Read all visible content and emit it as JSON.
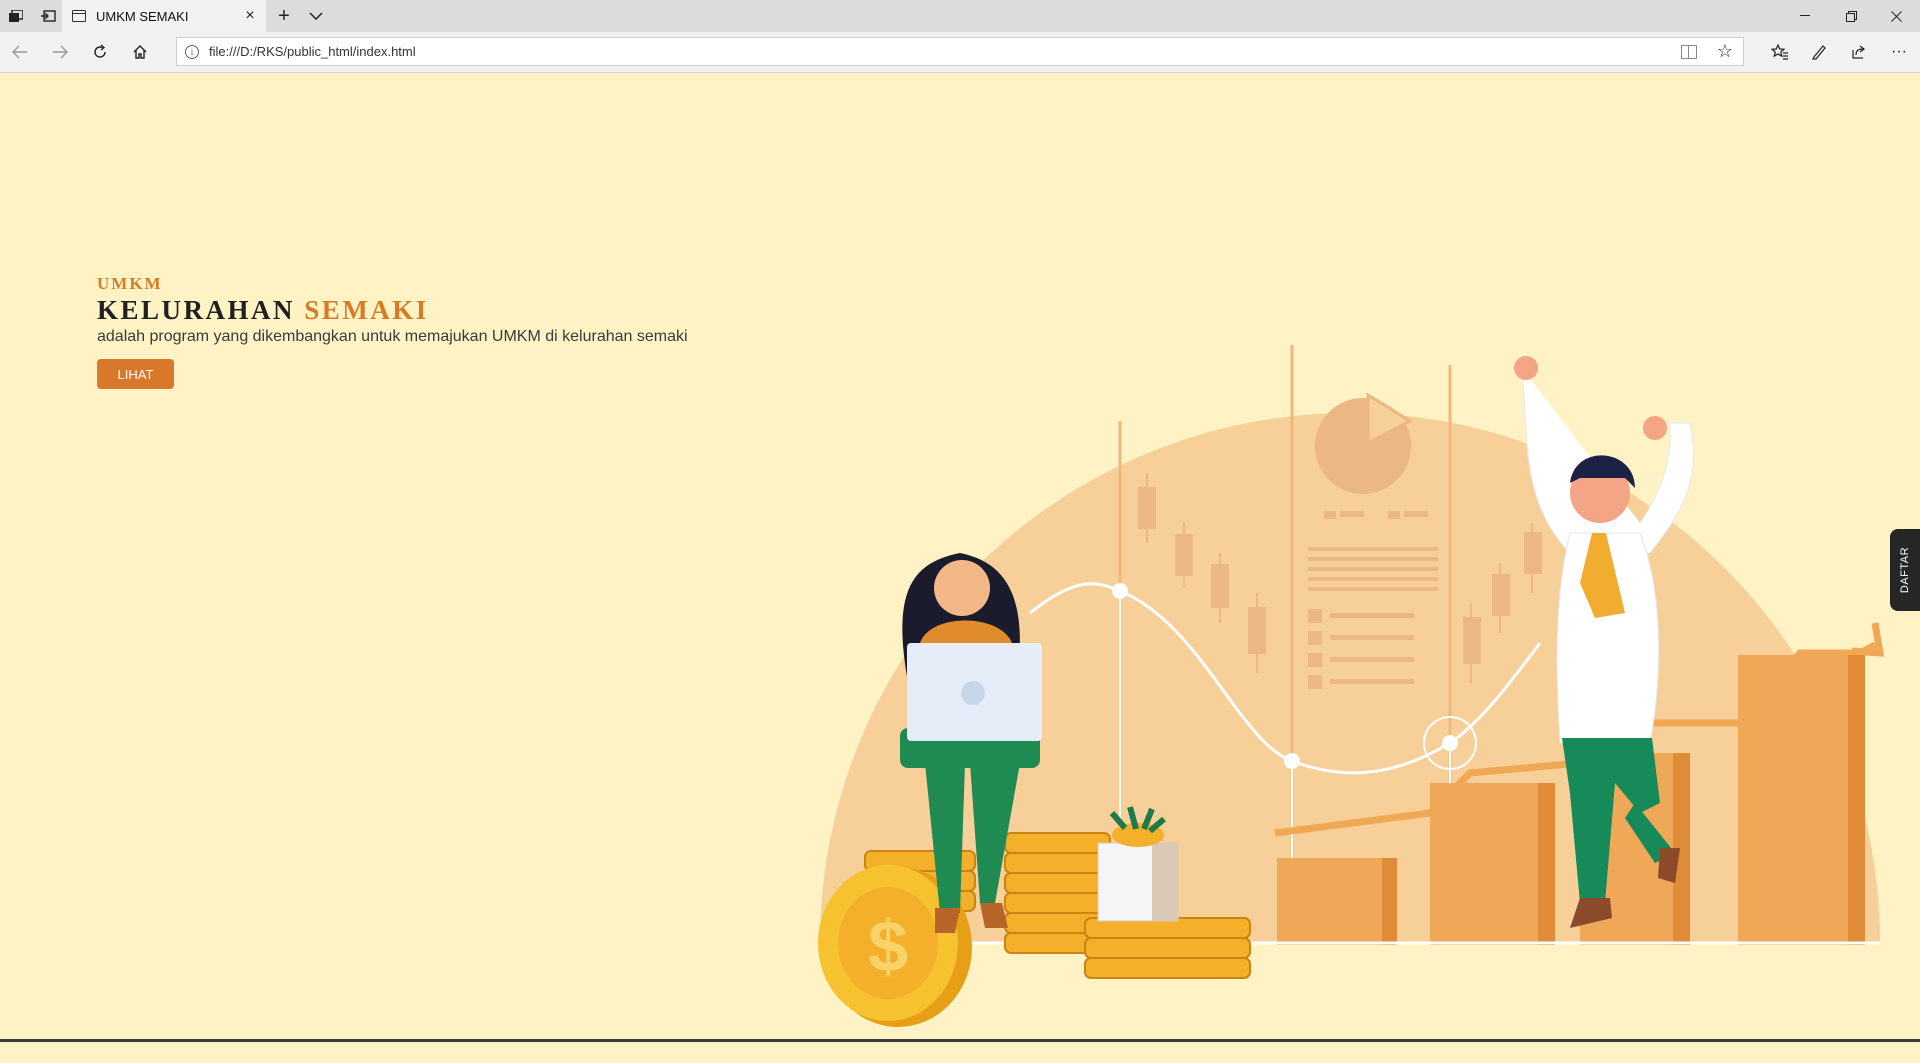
{
  "browser": {
    "tab_title": "UMKM SEMAKI",
    "new_tab_symbol": "+",
    "close_symbol": "×",
    "url": "file:///D:/RKS/public_html/index.html",
    "info_symbol": "i",
    "star_symbol": "☆",
    "more_symbol": "···"
  },
  "hero": {
    "brand": "UMKM",
    "title_part1": "KELURAHAN",
    "title_part2": "SEMAKI",
    "description": "adalah program yang dikembangkan untuk memajukan UMKM di kelurahan semaki",
    "button_label": "LIHAT"
  },
  "side_tab": {
    "label": "DAFTAR"
  },
  "colors": {
    "background": "#fff3c6",
    "accent": "#d97b21",
    "title": "#202020",
    "button": "#d9782a",
    "side_tab": "#262626"
  },
  "icons": [
    "tab-actions-icon",
    "set-aside-icon",
    "page-icon",
    "close-icon",
    "plus-icon",
    "chevron-down-icon",
    "minimize-icon",
    "restore-icon",
    "window-close-icon",
    "back-icon",
    "forward-icon",
    "refresh-icon",
    "home-icon",
    "info-icon",
    "reading-view-icon",
    "star-icon",
    "favorites-icon",
    "pen-icon",
    "share-icon",
    "more-icon"
  ]
}
